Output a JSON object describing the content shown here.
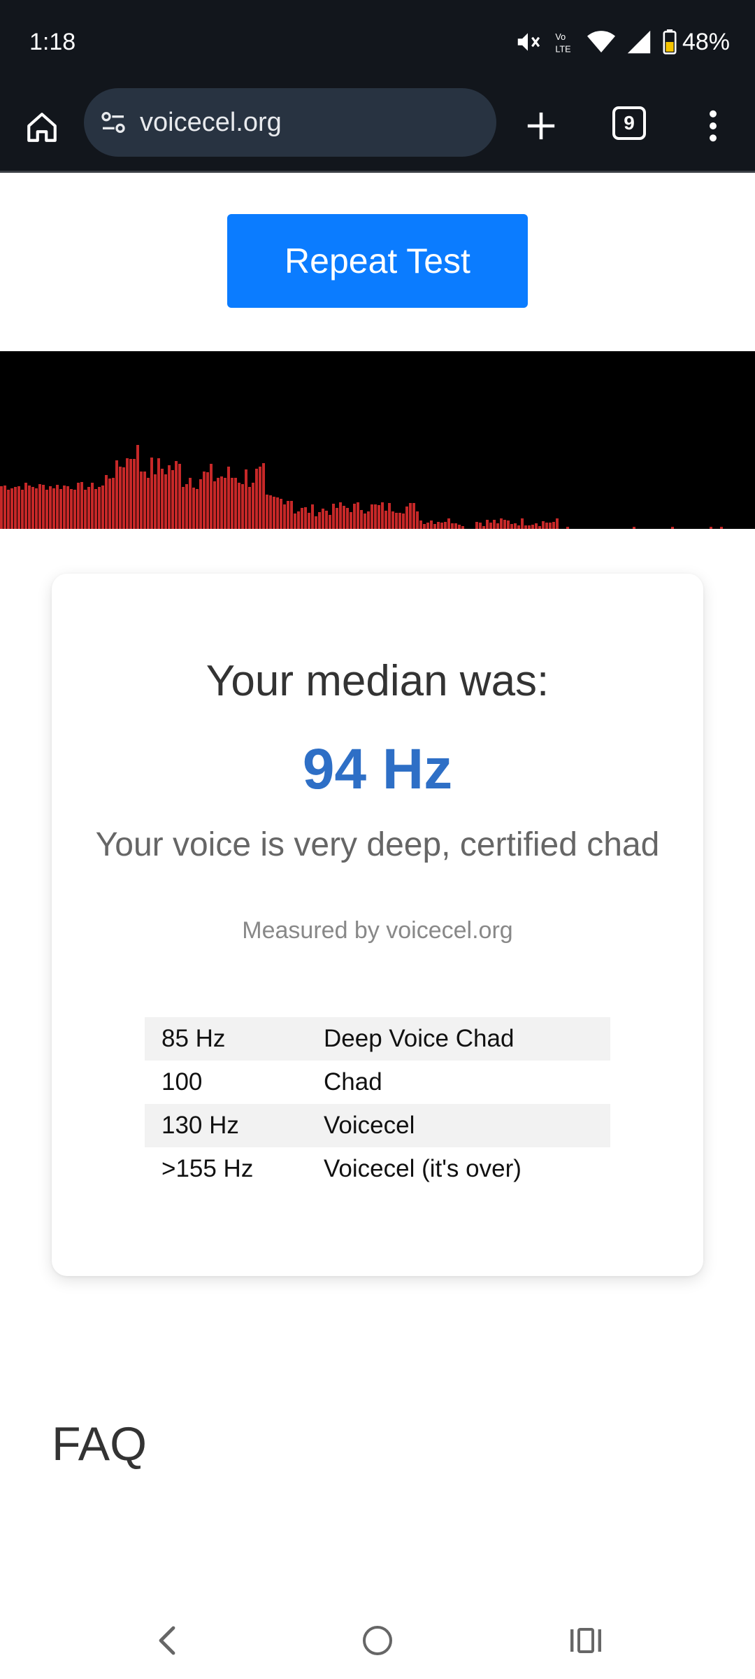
{
  "status_bar": {
    "time": "1:18",
    "battery": "48%",
    "icons": [
      "mute-icon",
      "volte-icon",
      "wifi-icon",
      "signal-icon",
      "battery-icon"
    ]
  },
  "browser": {
    "url": "voicecel.org",
    "tab_count": "9"
  },
  "page": {
    "repeat_button": "Repeat Test",
    "visualizer_color": "#c62828",
    "result": {
      "label": "Your median was:",
      "value": "94 Hz",
      "verdict": "Your voice is very deep, certified chad",
      "measured_by": "Measured by voicecel.org"
    },
    "ranges": [
      {
        "hz": "85 Hz",
        "label": "Deep Voice Chad"
      },
      {
        "hz": "100",
        "label": "Chad"
      },
      {
        "hz": "130 Hz",
        "label": "Voicecel"
      },
      {
        "hz": ">155 Hz",
        "label": "Voicecel (it's over)"
      }
    ],
    "faq_title": "FAQ"
  },
  "colors": {
    "accent_button": "#0b7cff",
    "median_value": "#2e6fc6",
    "status_bar_bg": "#12161c"
  }
}
